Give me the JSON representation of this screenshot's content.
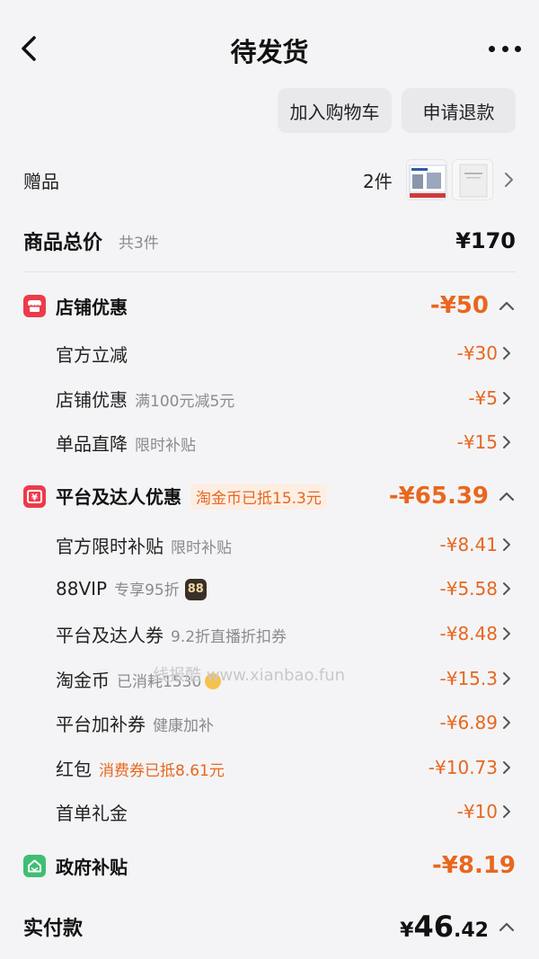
{
  "header": {
    "title": "待发货"
  },
  "actions": {
    "add_cart": "加入购物车",
    "refund": "申请退款"
  },
  "gift": {
    "label": "赠品",
    "count": "2件"
  },
  "total": {
    "label": "商品总价",
    "count": "共3件",
    "price": "¥170"
  },
  "shop": {
    "title": "店铺优惠",
    "amount": "-¥50",
    "items": [
      {
        "label": "官方立减",
        "sub": "",
        "amount": "-¥30"
      },
      {
        "label": "店铺优惠",
        "sub": "满100元减5元",
        "amount": "-¥5"
      },
      {
        "label": "单品直降",
        "sub": "限时补贴",
        "amount": "-¥15"
      }
    ]
  },
  "platform": {
    "title": "平台及达人优惠",
    "tag": "淘金币已抵15.3元",
    "amount": "-¥65.39",
    "items": [
      {
        "label": "官方限时补贴",
        "sub": "限时补贴",
        "amount": "-¥8.41"
      },
      {
        "label": "88VIP",
        "sub": "专享95折",
        "badge": "88",
        "amount": "-¥5.58"
      },
      {
        "label": "平台及达人券",
        "sub": "9.2折直播折扣券",
        "amount": "-¥8.48"
      },
      {
        "label": "淘金币",
        "sub": "已消耗1530",
        "amount": "-¥15.3"
      },
      {
        "label": "平台加补券",
        "sub": "健康加补",
        "amount": "-¥6.89"
      },
      {
        "label": "红包",
        "sub": "消费券已抵8.61元",
        "amount": "-¥10.73"
      },
      {
        "label": "首单礼金",
        "sub": "",
        "amount": "-¥10"
      }
    ]
  },
  "gov": {
    "title": "政府补贴",
    "amount": "-¥8.19"
  },
  "paid": {
    "label": "实付款",
    "symbol": "¥",
    "integer": "46",
    "decimal": ".42"
  },
  "watermark": "线报酷 www.xianbao.fun",
  "colors": {
    "accent": "#e8671e",
    "shop_icon": "#ec3b4a",
    "gov_icon": "#3fbf73"
  }
}
